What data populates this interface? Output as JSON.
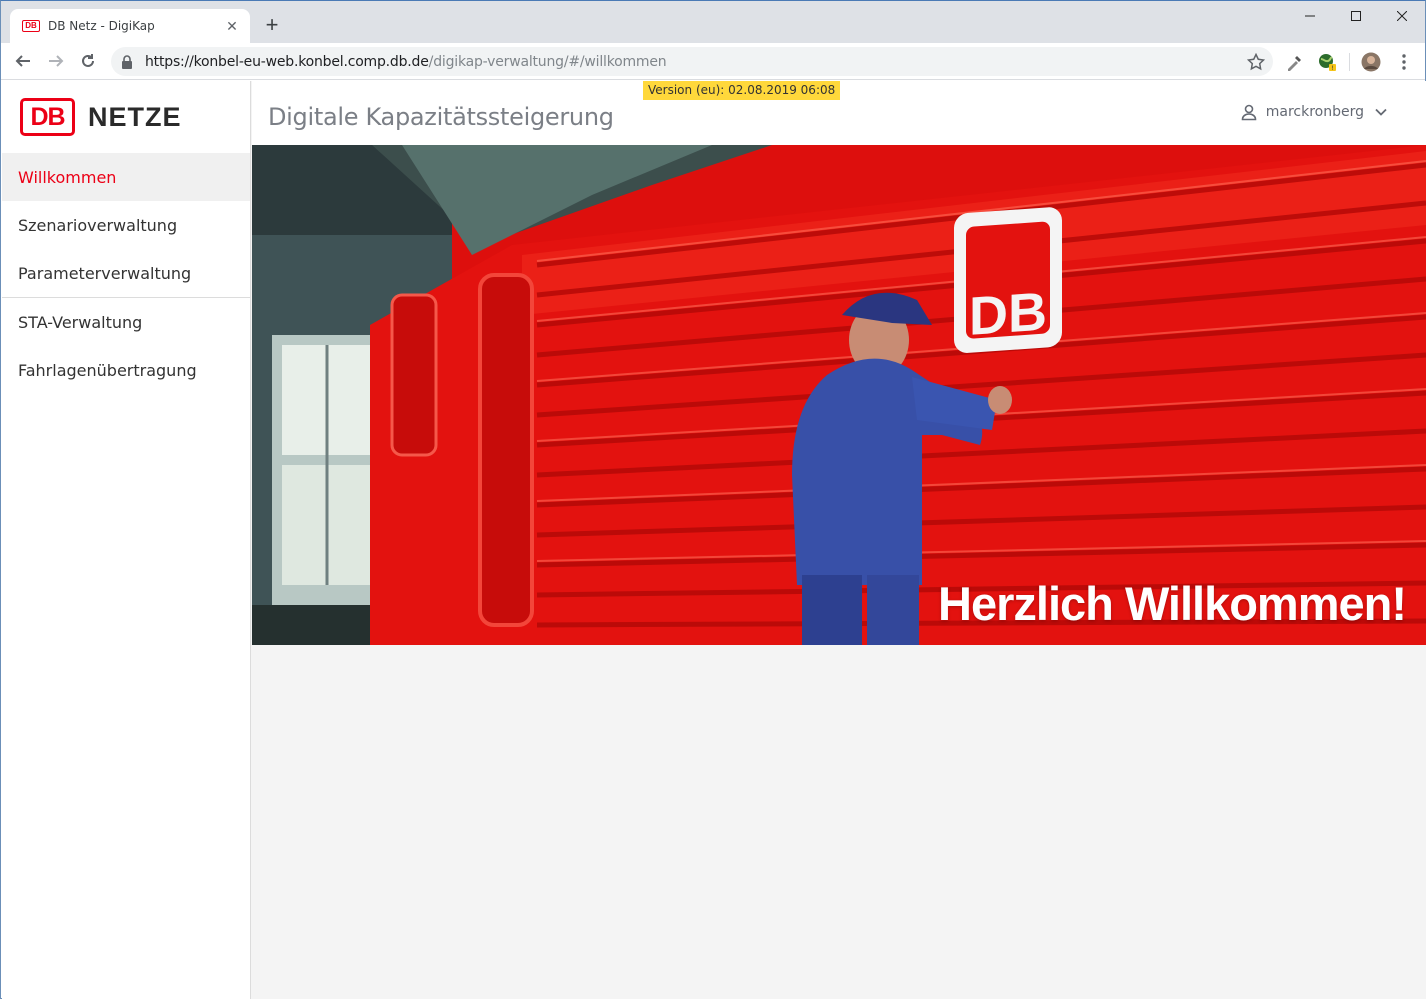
{
  "browser": {
    "tab_title": "DB Netz - DigiKap",
    "favicon_text": "DB",
    "url_host": "https://konbel-eu-web.konbel.comp.db.de",
    "url_path": "/digikap-verwaltung/#/willkommen"
  },
  "app": {
    "logo_db": "DB",
    "logo_netze": "NETZE",
    "page_title": "Digitale Kapazitätssteigerung",
    "version_badge": "Version (eu): 02.08.2019 06:08",
    "username": "marckronberg",
    "hero_text": "Herzlich Willkommen!",
    "accent_color": "#ec0016",
    "version_color": "#ffd83b"
  },
  "sidebar": {
    "items": [
      {
        "label": "Willkommen",
        "active": true
      },
      {
        "label": "Szenarioverwaltung",
        "active": false
      },
      {
        "label": "Parameterverwaltung",
        "active": false
      },
      {
        "label": "STA-Verwaltung",
        "active": false
      },
      {
        "label": "Fahrlagenübertragung",
        "active": false
      }
    ]
  }
}
